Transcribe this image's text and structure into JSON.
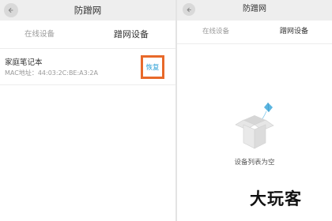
{
  "left_screen": {
    "title": "防蹭网",
    "tabs": [
      {
        "label": "在线设备",
        "active": false
      },
      {
        "label": "蹭网设备",
        "active": true
      }
    ],
    "device": {
      "name": "家庭笔记本",
      "mac": "MAC地址：44:03:2C:BE:A3:2A",
      "action_label": "恢复"
    }
  },
  "right_screen": {
    "title": "防蹭网",
    "tabs": [
      {
        "label": "在线设备",
        "active": false
      },
      {
        "label": "蹭网设备",
        "active": true
      }
    ],
    "empty_state": {
      "icon": "empty-box-icon",
      "message": "设备列表为空"
    }
  },
  "watermark": {
    "text": "大玩客"
  },
  "colors": {
    "highlight_border": "#e8692a",
    "action_text": "#2a9fd6",
    "titlebar_bg": "#eeeeee",
    "accent_blue": "#5bb5e0"
  }
}
